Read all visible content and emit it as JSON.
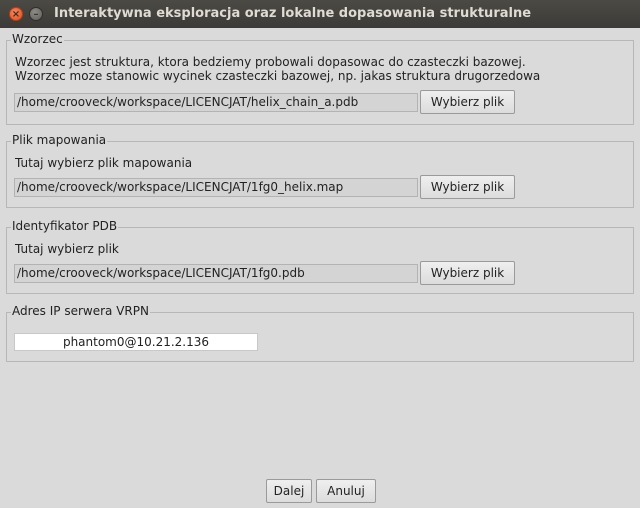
{
  "window": {
    "title": "Interaktywna eksploracja oraz lokalne dopasowania strukturalne",
    "close_glyph": "×",
    "minimize_glyph": "–"
  },
  "wzorzec": {
    "legend": "Wzorzec",
    "desc_line1": "Wzorzec jest struktura, ktora bedziemy probowali dopasowac do czasteczki bazowej.",
    "desc_line2": "Wzorzec moze stanowic wycinek czasteczki bazowej, np. jakas struktura drugorzedowa",
    "path": "/home/crooveck/workspace/LICENCJAT/helix_chain_a.pdb",
    "button": "Wybierz plik"
  },
  "mapowanie": {
    "legend": "Plik mapowania",
    "desc": "Tutaj wybierz plik mapowania",
    "path": "/home/crooveck/workspace/LICENCJAT/1fg0_helix.map",
    "button": "Wybierz plik"
  },
  "pdb": {
    "legend": "Identyfikator PDB",
    "desc": "Tutaj wybierz plik",
    "path": "/home/crooveck/workspace/LICENCJAT/1fg0.pdb",
    "button": "Wybierz plik"
  },
  "vrpn": {
    "legend": "Adres IP serwera VRPN",
    "value": "phantom0@10.21.2.136"
  },
  "footer": {
    "next": "Dalej",
    "cancel": "Anuluj"
  }
}
